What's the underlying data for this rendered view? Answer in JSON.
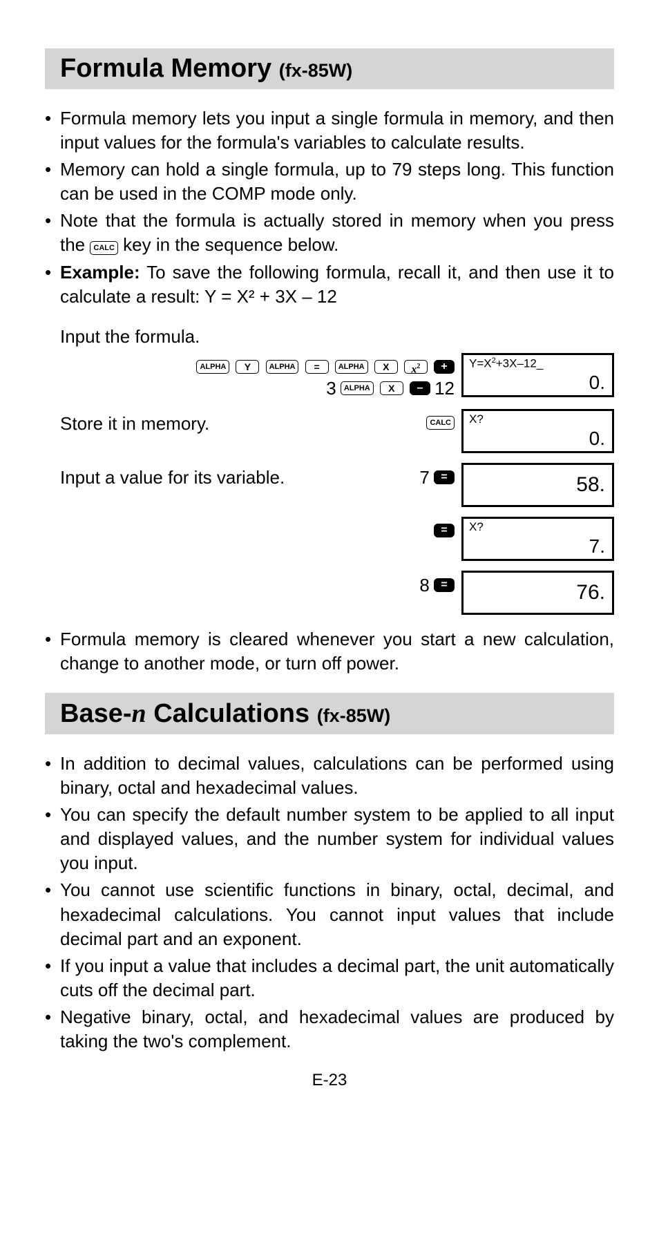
{
  "section1": {
    "title_main": "Formula Memory ",
    "title_model": "(fx-85W)",
    "bullets": [
      "Formula memory lets you input a single formula in memory, and then input values for the formula's variables to calculate results.",
      "Memory can hold a single formula, up to 79 steps long. This function can be used in the COMP mode only."
    ],
    "bullet3_pre": "Note that the formula is actually stored in memory when you press the ",
    "bullet3_key": "CALC",
    "bullet3_post": " key in the sequence below.",
    "example_label": "Example:",
    "example_text": "  To save the following formula, recall it, and then use it to calculate a result: Y = X² + 3X – 12",
    "input_formula_label": "Input the formula.",
    "store_label": "Store it in memory.",
    "value_label": "Input a value for its variable.",
    "bullet_clear": "Formula memory is cleared whenever you start a new calculation, change to another mode, or turn off power.",
    "keys": {
      "alpha": "ALPHA",
      "y": "Y",
      "eq": "=",
      "x": "X",
      "x2": "x²",
      "plus": "+",
      "minus": "–",
      "calc": "CALC",
      "exe": "="
    },
    "nums": {
      "three": "3",
      "twelve": "12",
      "seven": "7",
      "eight": "8"
    },
    "displays": {
      "d1_top": "Y=X²+3X–12_",
      "d1_val": "0.",
      "d2_top": "X?",
      "d2_val": "0.",
      "d3_val": "58.",
      "d4_top": "X?",
      "d4_val": "7.",
      "d5_val": "76."
    }
  },
  "section2": {
    "title_pre": "Base-",
    "title_n": "n",
    "title_post": " Calculations ",
    "title_model": "(fx-85W)",
    "bullets": [
      "In addition to decimal values, calculations can be performed using binary, octal and hexadecimal values.",
      "You can specify the default number system to be applied to all input and displayed values, and the number system for individual values you input.",
      "You cannot use scientific functions in binary, octal, decimal, and hexadecimal calculations. You cannot input values that include decimal part and an exponent.",
      "If you input a value that includes a decimal part, the unit automatically cuts off the decimal part.",
      "Negative binary, octal, and hexadecimal values are produced by taking the two's complement."
    ]
  },
  "page_number": "E-23"
}
